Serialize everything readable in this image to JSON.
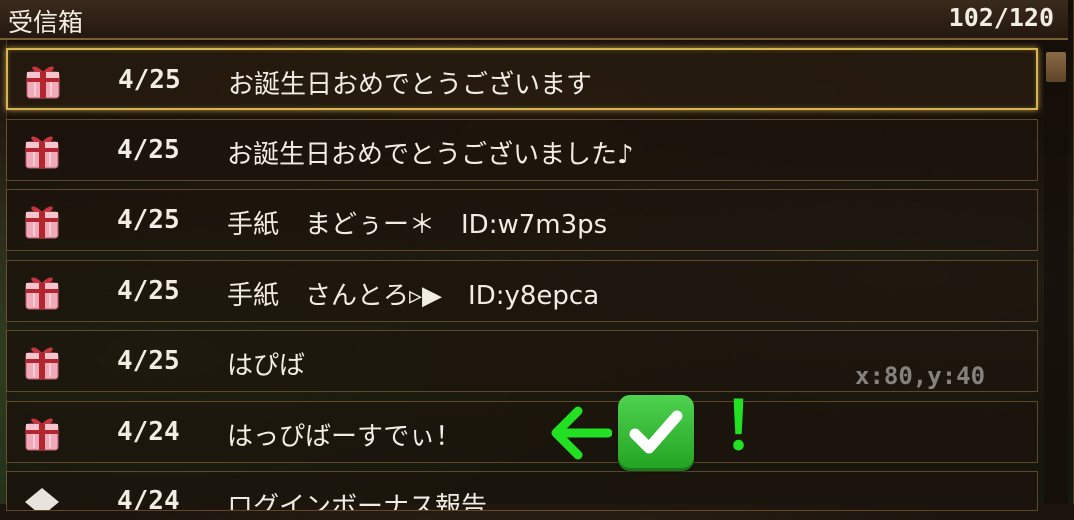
{
  "header": {
    "title": "受信箱",
    "count": "102/120"
  },
  "mails": [
    {
      "date": "4/25",
      "subject": "お誕生日おめでとうございます",
      "icon": "gift-box-icon",
      "selected": true
    },
    {
      "date": "4/25",
      "subject": "お誕生日おめでとうございました♪",
      "icon": "gift-box-icon",
      "selected": false
    },
    {
      "date": "4/25",
      "subject": "手紙　まどぅー＊　ID:w7m3ps",
      "icon": "gift-box-icon",
      "selected": false
    },
    {
      "date": "4/25",
      "subject": "手紙　さんとろ▹▶　ID:y8epca",
      "icon": "gift-box-icon",
      "selected": false
    },
    {
      "date": "4/25",
      "subject": "はぴば",
      "icon": "gift-box-icon",
      "selected": false
    },
    {
      "date": "4/24",
      "subject": "はっぴばーすでぃ！",
      "icon": "gift-box-icon",
      "selected": false
    },
    {
      "date": "4/24",
      "subject": "ログインボーナス報告",
      "icon": "envelope-icon",
      "selected": false
    }
  ],
  "coord_readout": "x:80,y:40",
  "annotation": {
    "exclamation": "！",
    "arrow_color": "#22e022",
    "check_icon": "white-check-mark-button-icon"
  },
  "colors": {
    "selection_border": "#d8b552",
    "row_border": "#96734680",
    "gift_pink": "#f0a9b8",
    "gift_ribbon": "#b3262f"
  }
}
